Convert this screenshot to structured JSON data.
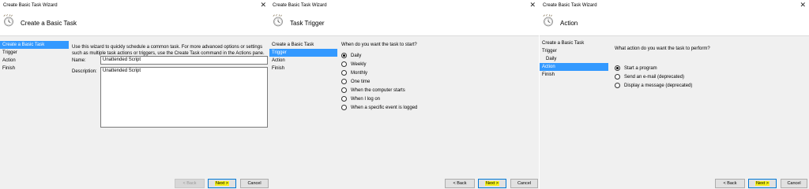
{
  "panels": [
    {
      "window_title": "Create Basic Task Wizard",
      "header_title": "Create a Basic Task",
      "steps": [
        "Create a Basic Task",
        "Trigger",
        "Action",
        "Finish"
      ],
      "intro_line1": "Use this wizard to quickly schedule a common task.  For more advanced options or settings",
      "intro_line2": "such as multiple task actions or triggers, use the Create Task command in the Actions pane.",
      "name_label": "Name:",
      "name_value": "Unattended Script",
      "description_label": "Description:",
      "description_value": "Unattended Script",
      "back_label": "< Back",
      "next_label": "Next >",
      "cancel_label": "Cancel"
    },
    {
      "window_title": "Create Basic Task Wizard",
      "header_title": "Task Trigger",
      "steps": [
        "Create a Basic Task",
        "Trigger",
        "Action",
        "Finish"
      ],
      "question": "When do you want the task to start?",
      "options": [
        "Daily",
        "Weekly",
        "Monthly",
        "One time",
        "When the computer starts",
        "When I log on",
        "When a specific event is logged"
      ],
      "selected_option": "Daily",
      "back_label": "< Back",
      "next_label": "Next >",
      "cancel_label": "Cancel"
    },
    {
      "window_title": "Create Basic Task Wizard",
      "header_title": "Action",
      "steps": [
        "Create a Basic Task",
        "Trigger",
        "Daily",
        "Action",
        "Finish"
      ],
      "question": "What action do you want the task to perform?",
      "options": [
        "Start a program",
        "Send an e-mail (deprecated)",
        "Display a message (deprecated)"
      ],
      "selected_option": "Start a program",
      "back_label": "< Back",
      "next_label": "Next >",
      "cancel_label": "Cancel"
    }
  ],
  "colors": {
    "selection": "#3399ff",
    "next_highlight": "#f5f21a",
    "focus_border": "#0078d7"
  },
  "icons": {
    "header": "task-scheduler-clock-icon",
    "close": "close-icon"
  }
}
